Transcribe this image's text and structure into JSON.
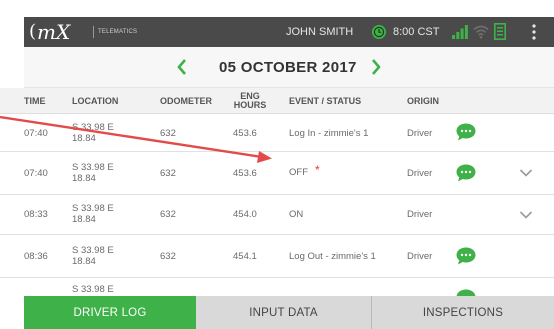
{
  "header": {
    "logo_text": "mX",
    "logo_paren": "(",
    "brand_sub": "TELEMATICS",
    "user": "JOHN SMITH",
    "time": "8:00 CST",
    "icons": [
      "clock-icon",
      "signal-icon",
      "wifi-icon",
      "document-icon",
      "menu-icon"
    ]
  },
  "date_nav": {
    "prev_symbol": "<",
    "date": "05 OCTOBER 2017",
    "next_symbol": ">"
  },
  "columns": {
    "time": "TIME",
    "location": "LOCATION",
    "odometer": "ODOMETER",
    "eng_hours": "ENG HOURS",
    "event_status": "EVENT / STATUS",
    "origin": "ORIGIN"
  },
  "rows": [
    {
      "time": "07:40",
      "location": "S 33.98 E 18.84",
      "odometer": "632",
      "eng_hours": "453.6",
      "event": "Log In - zimmie's 1",
      "origin": "Driver",
      "has_chat": true,
      "has_expand": false
    },
    {
      "time": "07:40",
      "location": "S 33.98 E 18.84",
      "odometer": "632",
      "eng_hours": "453.6",
      "event": "OFF*",
      "required_mark": "*",
      "origin": "Driver",
      "has_chat": true,
      "has_expand": true
    },
    {
      "time": "08:33",
      "location": "S 33.98 E 18.84",
      "odometer": "632",
      "eng_hours": "454.0",
      "event": "ON",
      "origin": "Driver",
      "has_chat": false,
      "has_expand": true
    },
    {
      "time": "08:36",
      "location": "S 33.98 E 18.84",
      "odometer": "632",
      "eng_hours": "454.1",
      "event": "Log Out - zimmie's 1",
      "origin": "Driver",
      "has_chat": true,
      "has_expand": false
    },
    {
      "location": "S 33.98 E",
      "has_chat": true
    }
  ],
  "tabs": [
    {
      "label": "DRIVER LOG",
      "active": true
    },
    {
      "label": "INPUT DATA",
      "active": false
    },
    {
      "label": "INSPECTIONS",
      "active": false
    }
  ],
  "colors": {
    "brand_green": "#3fb149",
    "header_dark": "#4a4a4a",
    "annotation_red": "#e34b4b",
    "status_star": "#e0393c"
  }
}
